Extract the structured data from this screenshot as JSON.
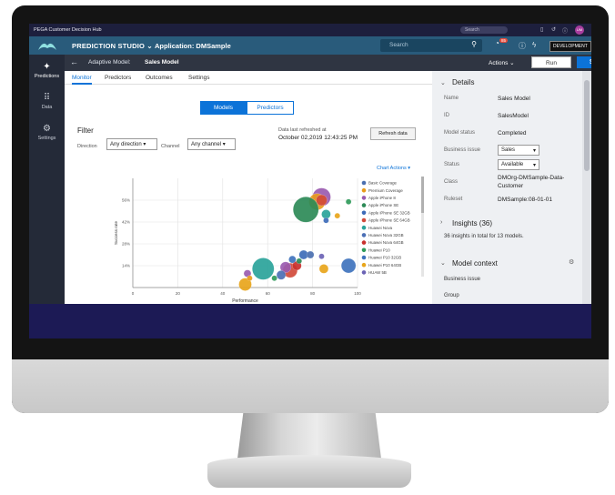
{
  "os_bar": {
    "brand": "PEGA  Customer Decision Hub",
    "search_placeholder": "Search"
  },
  "app_bar": {
    "studio": "PREDICTION STUDIO",
    "application_label": "Application:  DMSample",
    "search_placeholder": "Search",
    "notification_count": "85",
    "environment": "DEVELOPMENT"
  },
  "left_nav": [
    {
      "label": "Predictions",
      "icon": "sparkle-icon"
    },
    {
      "label": "Data",
      "icon": "grid-icon"
    },
    {
      "label": "Settings",
      "icon": "gear-icon"
    }
  ],
  "sub_bar": {
    "model_type": "Adaptive Model:",
    "model_name": "Sales Model",
    "actions": "Actions",
    "run": "Run",
    "save": "Save"
  },
  "tabs": [
    "Monitor",
    "Predictors",
    "Outcomes",
    "Settings"
  ],
  "segment": {
    "models": "Models",
    "predictors": "Predictors"
  },
  "filter": {
    "title": "Filter",
    "direction_label": "Direction",
    "direction_value": "Any direction",
    "channel_label": "Channel",
    "channel_value": "Any channel"
  },
  "refresh": {
    "label": "Data last refreshed at",
    "date": "October 02,2019 12:43:25 PM",
    "button": "Refresh data"
  },
  "chart_actions": "Chart Actions",
  "details": {
    "title": "Details",
    "name_label": "Name",
    "name": "Sales Model",
    "id_label": "ID",
    "id": "SalesModel",
    "status_label": "Model status",
    "status": "Completed",
    "issue_label": "Business issue",
    "issue": "Sales",
    "state_label": "Status",
    "state": "Available",
    "class_label": "Class",
    "class_line1": "DMOrg-DMSample-Data-",
    "class_line2": "Customer",
    "ruleset_label": "Ruleset",
    "ruleset": "DMSample:08-01-01"
  },
  "insights": {
    "title": "Insights (36)",
    "text": "36 insights in total for 13 models."
  },
  "model_context": {
    "title": "Model context",
    "items": [
      "Business issue",
      "Group"
    ]
  },
  "colors": {
    "accent": "#0c73d8",
    "appbar": "#295b7b",
    "osbar": "#1d1f3d",
    "banner": "#1c1a55"
  },
  "chart_data": {
    "type": "scatter",
    "xlabel": "Performance",
    "ylabel": "Success rate",
    "xlim": [
      0,
      100
    ],
    "x_ticks": [
      0,
      20,
      40,
      60,
      80,
      100
    ],
    "y_ticks": [
      "14%",
      "28%",
      "42%",
      "56%"
    ],
    "y_tick_values": [
      14,
      28,
      42,
      56
    ],
    "ylim": [
      0,
      70
    ],
    "grid": true,
    "legend_position": "right",
    "legend": [
      {
        "name": "Basic Coverage",
        "color": "#4a6fb0"
      },
      {
        "name": "Premium Coverage",
        "color": "#e89b1c"
      },
      {
        "name": "Apple iPhone 8",
        "color": "#9a5bb0"
      },
      {
        "name": "Apple iPhone SE",
        "color": "#2d8a57"
      },
      {
        "name": "Apple iPhone SE 32GB",
        "color": "#3d6bb8"
      },
      {
        "name": "Apple iPhone SE 64GB",
        "color": "#d14a3a"
      },
      {
        "name": "Huawei Nova",
        "color": "#2aa39a"
      },
      {
        "name": "Huawei Nova 32GB",
        "color": "#4b6fb5"
      },
      {
        "name": "Huawei Nova 64GB",
        "color": "#c9302c"
      },
      {
        "name": "Huawei P10",
        "color": "#2f9a5a"
      },
      {
        "name": "Huawei P10 32GB",
        "color": "#3f73bd"
      },
      {
        "name": "Huawei P10 64GB",
        "color": "#e8a51b"
      },
      {
        "name": "HUAW 5B",
        "color": "#6b63b5"
      }
    ],
    "points": [
      {
        "x": 84,
        "y": 58,
        "size": 10,
        "color": "#9a5bb0"
      },
      {
        "x": 82,
        "y": 55,
        "size": 9,
        "color": "#e89b1c"
      },
      {
        "x": 84,
        "y": 56,
        "size": 6,
        "color": "#d14a3a"
      },
      {
        "x": 77,
        "y": 50,
        "size": 14,
        "color": "#2d8a57"
      },
      {
        "x": 86,
        "y": 47,
        "size": 5,
        "color": "#2aa39a"
      },
      {
        "x": 91,
        "y": 46,
        "size": 3,
        "color": "#e8a51b"
      },
      {
        "x": 86,
        "y": 43,
        "size": 3,
        "color": "#3d6bb8"
      },
      {
        "x": 96,
        "y": 55,
        "size": 3,
        "color": "#2f9a5a"
      },
      {
        "x": 58,
        "y": 12,
        "size": 12,
        "color": "#2aa39a"
      },
      {
        "x": 70,
        "y": 11,
        "size": 8,
        "color": "#d14a3a"
      },
      {
        "x": 68,
        "y": 13,
        "size": 6,
        "color": "#9a5bb0"
      },
      {
        "x": 73,
        "y": 14,
        "size": 5,
        "color": "#c9302c"
      },
      {
        "x": 71,
        "y": 18,
        "size": 4,
        "color": "#3f73bd"
      },
      {
        "x": 76,
        "y": 21,
        "size": 5,
        "color": "#3d6bb8"
      },
      {
        "x": 79,
        "y": 21,
        "size": 4,
        "color": "#4a6fb0"
      },
      {
        "x": 84,
        "y": 20,
        "size": 3,
        "color": "#6b63b5"
      },
      {
        "x": 85,
        "y": 12,
        "size": 5,
        "color": "#e8a51b"
      },
      {
        "x": 96,
        "y": 14,
        "size": 8,
        "color": "#3f73bd"
      },
      {
        "x": 74,
        "y": 17,
        "size": 3,
        "color": "#2d8a57"
      },
      {
        "x": 66,
        "y": 8,
        "size": 5,
        "color": "#4b6fb5"
      },
      {
        "x": 63,
        "y": 6,
        "size": 3,
        "color": "#2f9a5a"
      },
      {
        "x": 51,
        "y": 9,
        "size": 4,
        "color": "#9a5bb0"
      },
      {
        "x": 50,
        "y": 2,
        "size": 7,
        "color": "#e8a51b"
      },
      {
        "x": 52,
        "y": 6,
        "size": 3,
        "color": "#e89b1c"
      }
    ]
  }
}
